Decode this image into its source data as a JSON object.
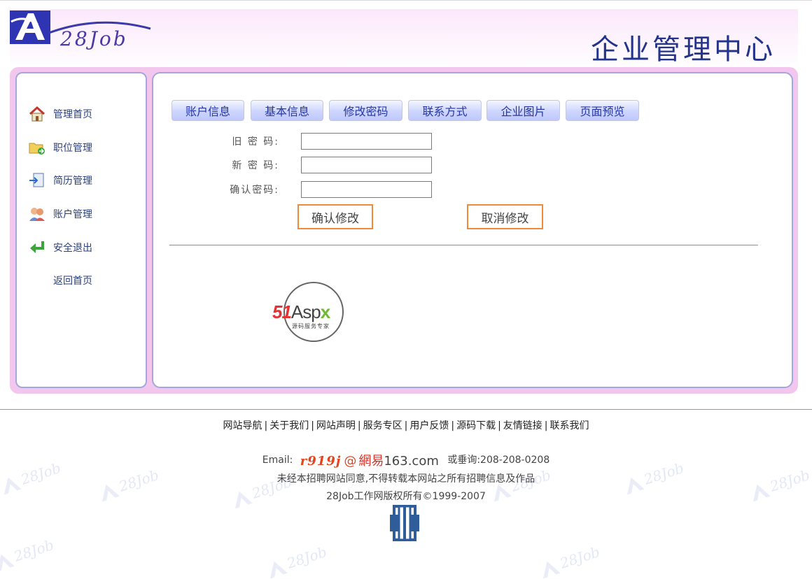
{
  "header": {
    "logo_text": "28Job",
    "title": "企业管理中心"
  },
  "watermark_text": "28Job",
  "sidebar": {
    "items": [
      {
        "label": "管理首页",
        "icon": "home-icon"
      },
      {
        "label": "职位管理",
        "icon": "folder-arrow-icon"
      },
      {
        "label": "简历管理",
        "icon": "document-import-icon"
      },
      {
        "label": "账户管理",
        "icon": "users-icon"
      },
      {
        "label": "安全退出",
        "icon": "exit-arrow-icon"
      },
      {
        "label": "返回首页",
        "icon": ""
      }
    ]
  },
  "tabs": [
    {
      "label": "账户信息"
    },
    {
      "label": "基本信息"
    },
    {
      "label": "修改密码"
    },
    {
      "label": "联系方式"
    },
    {
      "label": "企业图片"
    },
    {
      "label": "页面预览"
    }
  ],
  "form": {
    "old_password_label": "旧 密 码:",
    "new_password_label": "新 密 码:",
    "confirm_password_label": "确认密码:",
    "old_password_value": "",
    "new_password_value": "",
    "confirm_password_value": "",
    "confirm_button": "确认修改",
    "cancel_button": "取消修改"
  },
  "badge": {
    "brand_51": "51",
    "brand_asp": "Asp",
    "brand_x": "x",
    "tagline": "源码服务专家"
  },
  "footer": {
    "links": [
      "网站导航",
      "关于我们",
      "网站声明",
      "服务专区",
      "用户反馈",
      "源码下载",
      "友情链接",
      "联系我们"
    ],
    "separator": "|",
    "email_label": "Email:",
    "email_user": "r919j",
    "email_at": "@",
    "email_domain": "網易",
    "email_domain_suffix": "163.com",
    "phone_text": "或垂询:208-208-0208",
    "notice": "未经本招聘网站同意,不得转载本网站之所有招聘信息及作品",
    "copyright": "28Job工作网版权所有©1999-2007"
  },
  "colors": {
    "tab_text": "#2536a8",
    "frame_pink": "#f3c6ee",
    "panel_border": "#a3a7dc",
    "button_border": "#ee8a3a",
    "title_blue": "#23348a"
  }
}
